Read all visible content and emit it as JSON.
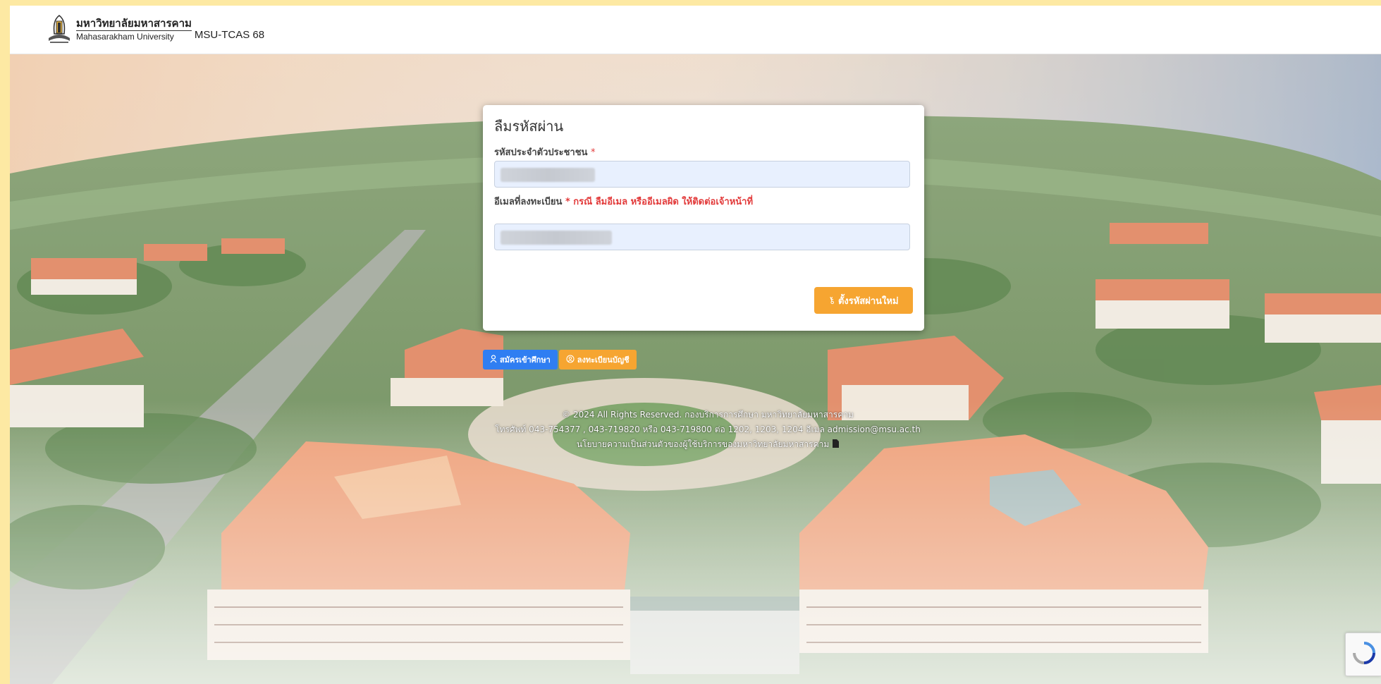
{
  "navbar": {
    "university_thai": "มหาวิทยาลัยมหาสารคาม",
    "university_en": "Mahasarakham University",
    "app_name": "MSU-TCAS 68"
  },
  "modal": {
    "title": "ลืมรหัสผ่าน",
    "citizen_id_label": "รหัสประจำตัวประชาชน",
    "required_mark": "*",
    "email_label": "อีเมลที่ลงทะเบียน",
    "email_note": "* กรณี ลืมอีเมล หรืออีเมลผิด ให้ติดต่อเจ้าหน้าที่",
    "submit_label": "ตั้งรหัสผ่านใหม่",
    "submit_icon": "key-icon"
  },
  "actions": {
    "apply_label": "สมัครเข้าศึกษา",
    "apply_icon": "user-icon",
    "register_label": "ลงทะเบียนบัญชี",
    "register_icon": "user-circle-icon"
  },
  "footer": {
    "copyright": "© 2024 All Rights Reserved. กองบริการการศึกษา มหาวิทยาลัยมหาสารคาม",
    "contact": "โทรศัพท์ 043-754377 , 043-719820 หรือ 043-719800 ต่อ 1202, 1203, 1204 อีเมล admission@msu.ac.th",
    "privacy": "นโยบายความเป็นส่วนตัวของผู้ใช้บริการของมหาวิทยาลัยมหาสารคาม",
    "privacy_icon": "document-icon"
  },
  "colors": {
    "primary_orange": "#f6a531",
    "primary_blue": "#2f7ef2",
    "required_red": "#e23b3b",
    "input_bg": "#e8f0fe",
    "page_border": "#fde9a3"
  }
}
